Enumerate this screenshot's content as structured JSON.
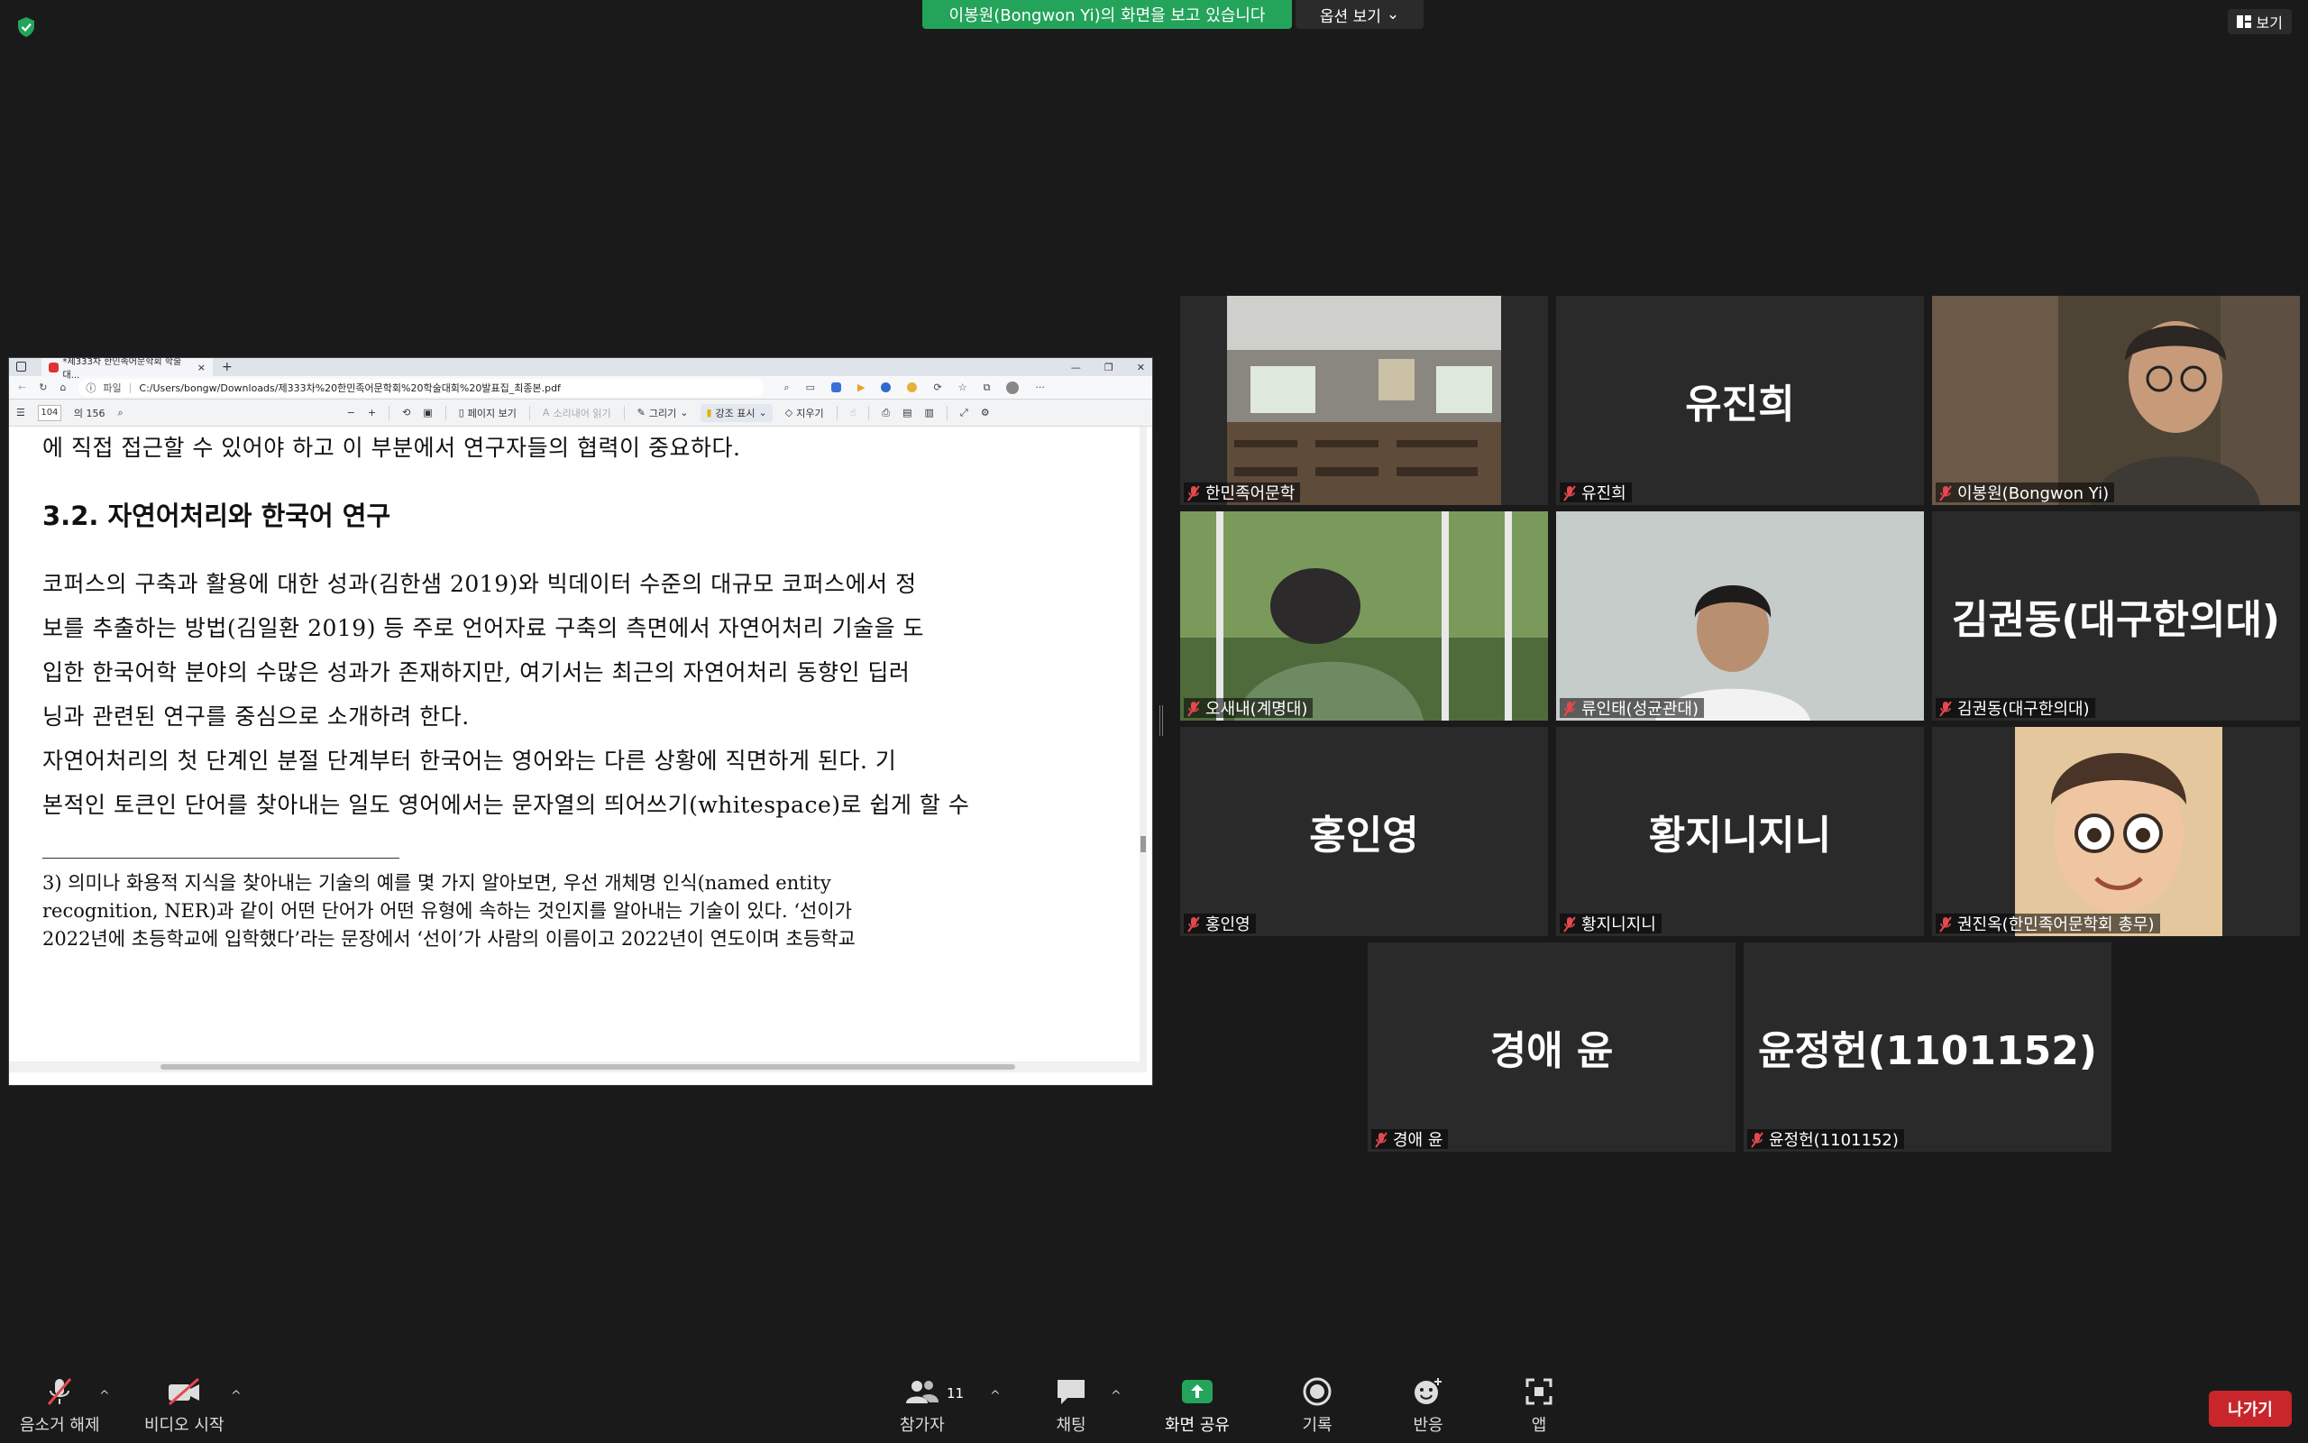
{
  "banner": {
    "sharing_text": "이봉원(Bongwon Yi)의 화면을 보고 있습니다",
    "view_options": "옵션 보기",
    "view_label": "보기"
  },
  "browser": {
    "tab_title": "*제333차 한민족어문학회 학술대...",
    "url_prefix": "파일",
    "url": "C:/Users/bongw/Downloads/제333차%20한민족어문학회%20학술대회%20발표집_최종본.pdf",
    "page_current": "104",
    "page_total": "의 156",
    "tools": {
      "page_view": "페이지 보기",
      "read_aloud": "소리내어 읽기",
      "draw": "그리기",
      "highlight": "강조 표시",
      "erase": "지우기"
    }
  },
  "pdf": {
    "line0": "에 직접 접근할 수 있어야 하고 이 부분에서 연구자들의 협력이 중요하다.",
    "heading": "3.2. 자연어처리와 한국어 연구",
    "p1": [
      "  코퍼스의 구축과 활용에 대한 성과(김한샘 2019)와 빅데이터 수준의 대규모 코퍼스에서 정",
      "보를 추출하는 방법(김일환 2019) 등 주로 언어자료 구축의 측면에서 자연어처리 기술을 도",
      "입한 한국어학 분야의 수많은 성과가 존재하지만, 여기서는 최근의 자연어처리 동향인 딥러",
      "닝과 관련된 연구를 중심으로 소개하려 한다."
    ],
    "p2": [
      "  자연어처리의 첫 단계인 분절 단계부터 한국어는 영어와는 다른 상황에 직면하게 된다. 기",
      "본적인 토큰인 단어를 찾아내는 일도 영어에서는 문자열의 띄어쓰기(whitespace)로 쉽게 할 수"
    ],
    "footnote": [
      "3) 의미나 화용적 지식을 찾아내는 기술의 예를 몇 가지 알아보면, 우선 개체명 인식(named entity",
      "    recognition, NER)과 같이 어떤 단어가 어떤 유형에 속하는 것인지를 알아내는 기술이 있다. ‘선이가",
      "    2022년에 초등학교에 입학했다’라는 문장에서 ‘선이’가 사람의 이름이고 2022년이 연도이며 초등학교"
    ]
  },
  "participants": [
    {
      "label": "한민족어문학",
      "big": "",
      "type": "room"
    },
    {
      "label": "유진희",
      "big": "유진희",
      "type": "name"
    },
    {
      "label": "이봉원(Bongwon Yi)",
      "big": "",
      "type": "person",
      "speaking": true
    },
    {
      "label": "오새내(계명대)",
      "big": "",
      "type": "forest"
    },
    {
      "label": "류인태(성균관대)",
      "big": "",
      "type": "man"
    },
    {
      "label": "김권동(대구한의대)",
      "big": "김권동(대구한의대)",
      "type": "name"
    },
    {
      "label": "홍인영",
      "big": "홍인영",
      "type": "name"
    },
    {
      "label": "황지니지니",
      "big": "황지니지니",
      "type": "name"
    },
    {
      "label": "권진옥(한민족어문학회 총무)",
      "big": "",
      "type": "avatar"
    },
    {
      "label": "경애 윤",
      "big": "경애 윤",
      "type": "name"
    },
    {
      "label": "윤정헌(1101152)",
      "big": "윤정헌(1101152)",
      "type": "name"
    }
  ],
  "toolbar": {
    "mute": "음소거 해제",
    "video": "비디오 시작",
    "participants": "참가자",
    "participants_count": "11",
    "chat": "채팅",
    "share": "화면 공유",
    "record": "기록",
    "react": "반응",
    "apps": "앱",
    "leave": "나가기"
  },
  "colors": {
    "share_green": "#23a45a",
    "speaking_border": "#d8e34a",
    "leave_red": "#c8262b",
    "muted_red": "#e5484d"
  }
}
